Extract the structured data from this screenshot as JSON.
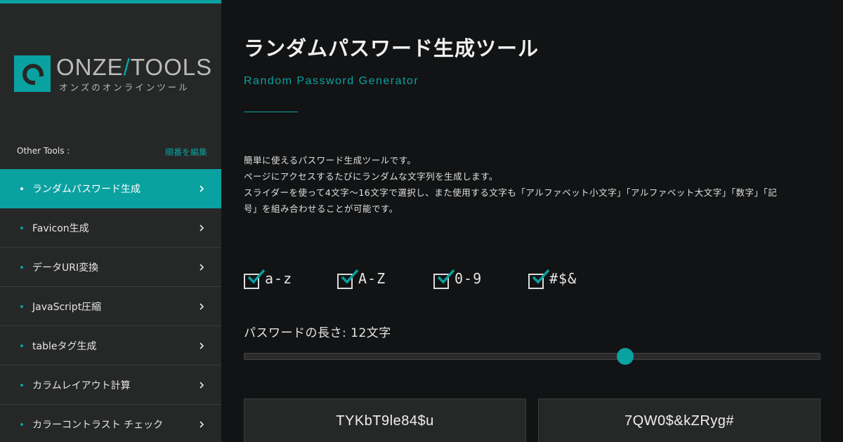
{
  "brand": {
    "name_left": "ONZE",
    "slash": "/",
    "name_right": "TOOLS",
    "tagline": "オンズのオンラインツール",
    "accent_color": "#0aa1a1"
  },
  "sidebar": {
    "section_label": "Other Tools :",
    "edit_link": "順番を編集",
    "items": [
      {
        "label": "ランダムパスワード生成",
        "active": true
      },
      {
        "label": "Favicon生成"
      },
      {
        "label": "データURI変換"
      },
      {
        "label": "JavaScript圧縮"
      },
      {
        "label": "tableタグ生成"
      },
      {
        "label": "カラムレイアウト計算"
      },
      {
        "label": "カラーコントラスト チェック"
      }
    ]
  },
  "main": {
    "title": "ランダムパスワード生成ツール",
    "subtitle": "Random Password Generator",
    "description": [
      "簡単に使えるパスワード生成ツールです。",
      "ページにアクセスするたびにランダムな文字列を生成します。",
      "スライダーを使って4文字〜16文字で選択し、また使用する文字も「アルファベット小文字」「アルファベット大文字」「数字」「記",
      "号」を組み合わせることが可能です。"
    ],
    "options": [
      {
        "label": "a-z",
        "checked": true
      },
      {
        "label": "A-Z",
        "checked": true
      },
      {
        "label": "0-9",
        "checked": true
      },
      {
        "label": "#$&",
        "checked": true
      }
    ],
    "length_label": "パスワードの長さ: 12文字",
    "slider": {
      "min": 4,
      "max": 16,
      "value": 12
    },
    "passwords": [
      "TYKbT9le84$u",
      "7QW0$&kZRyg#"
    ]
  }
}
